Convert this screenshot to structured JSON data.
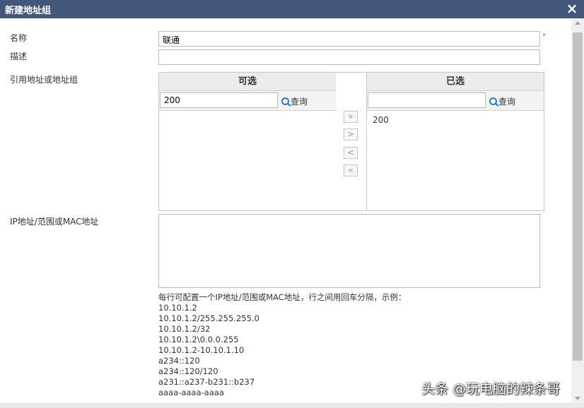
{
  "dialog": {
    "title": "新建地址组",
    "close_icon": "×"
  },
  "form": {
    "name_label": "名称",
    "name_value": "联通",
    "required_mark": "*",
    "desc_label": "描述",
    "desc_value": "",
    "ref_label": "引用地址或地址组",
    "ip_label": "IP地址/范围或MAC地址"
  },
  "available": {
    "header": "可选",
    "search_value": "200",
    "search_button": "查询",
    "items": []
  },
  "selected": {
    "header": "已选",
    "search_value": "",
    "search_button": "查询",
    "items": [
      "200"
    ]
  },
  "transfer_buttons": {
    "add_all": "»",
    "add_one": ">",
    "remove_one": "<",
    "remove_all": "«"
  },
  "help": {
    "intro": "每行可配置一个IP地址/范围或MAC地址，行之间用回车分隔，示例：",
    "examples": [
      "10.10.1.2",
      "10.10.1.2/255.255.255.0",
      "10.10.1.2/32",
      "10.10.1.2\\0.0.0.255",
      "10.10.1.2-10.10.1.10",
      "a234::120",
      "a234::120/120",
      "a231::a237-b231::b237",
      "aaaa-aaaa-aaaa"
    ]
  },
  "watermark": "头条 @玩电脑的辣条哥",
  "colors": {
    "titlebar": "#43577a",
    "required": "#d9534f",
    "search_icon": "#2a7cc7"
  }
}
